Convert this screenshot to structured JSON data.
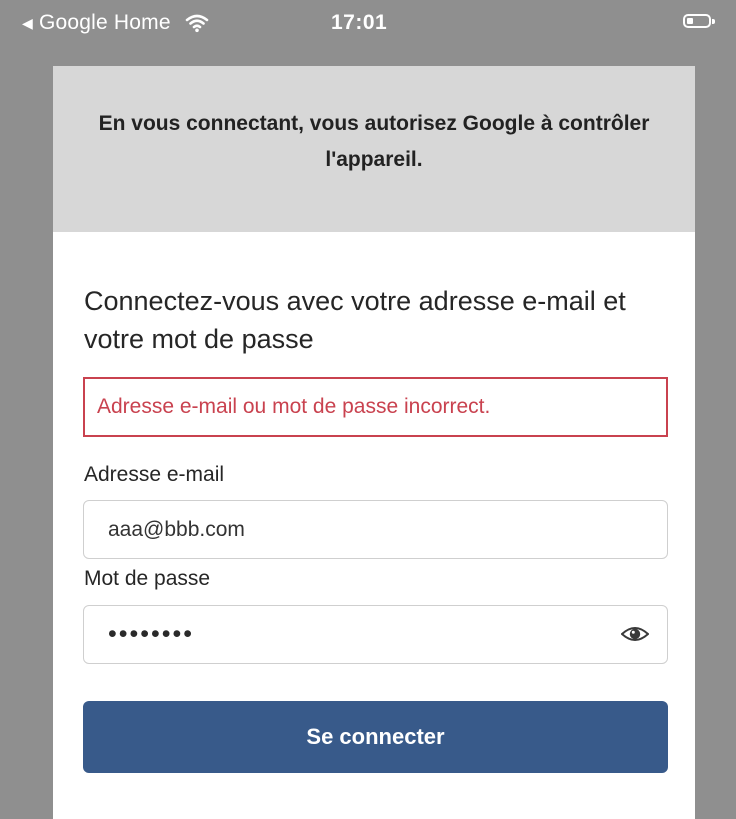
{
  "status_bar": {
    "back_app": "Google Home",
    "time": "17:01"
  },
  "dialog": {
    "header_text": "En vous connectant, vous autorisez Google à contrôler l'appareil.",
    "title": "Connectez-vous avec votre adresse e-mail et votre mot de passe",
    "error_message": "Adresse e-mail ou mot de passe incorrect.",
    "email_label": "Adresse e-mail",
    "email_value": "aaa@bbb.com",
    "password_label": "Mot de passe",
    "password_mask": "••••••••",
    "submit_label": "Se connecter"
  },
  "colors": {
    "accent": "#385a8a",
    "error": "#c9424f",
    "header_bg": "#d7d7d7",
    "backdrop": "#8f8f8f"
  },
  "icons": [
    "back-arrow-icon",
    "wifi-icon",
    "battery-icon",
    "eye-icon"
  ]
}
